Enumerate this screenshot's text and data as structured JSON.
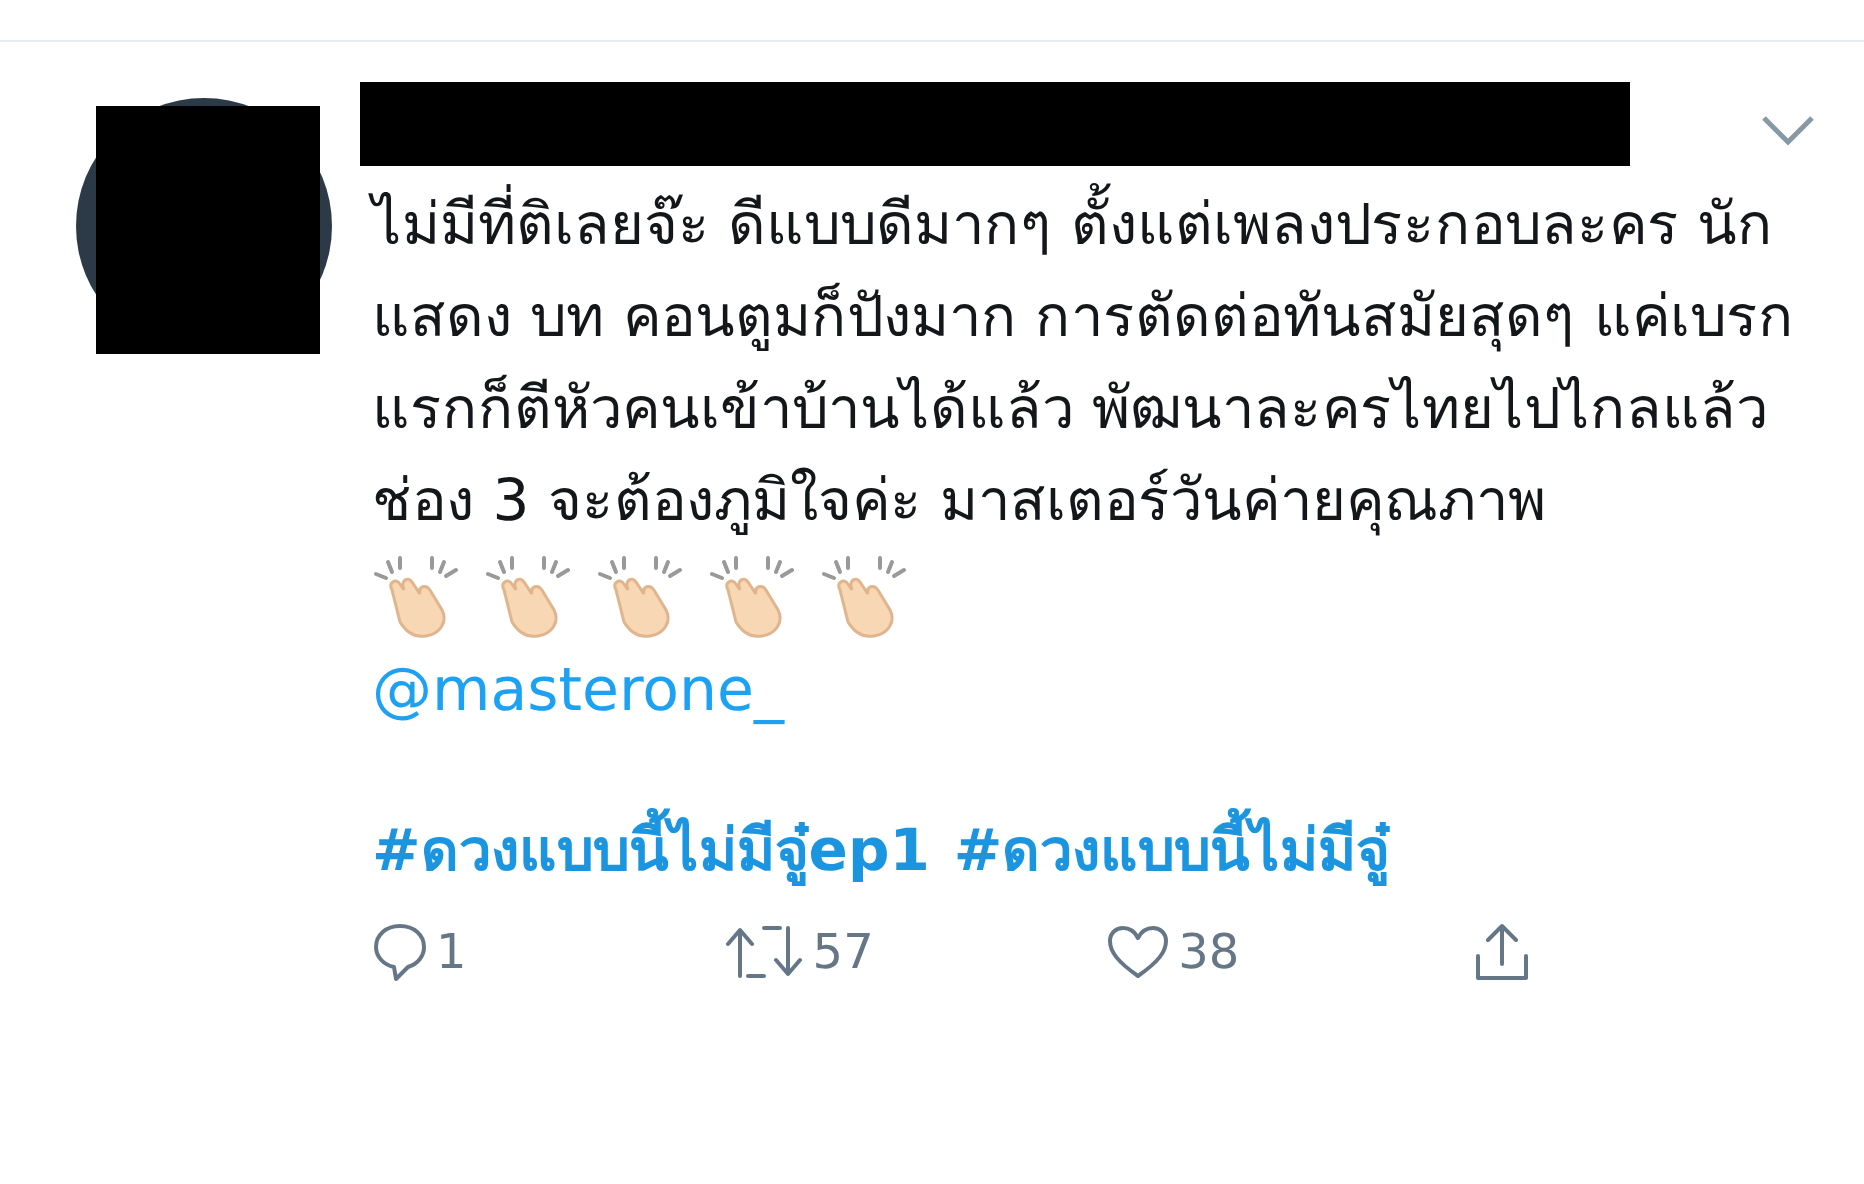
{
  "tweet": {
    "text": "ไม่มีที่ติเลยจ๊ะ ดีแบบดีมากๆ ตั้งแต่เพลงประกอบละคร นักแสดง บท คอนตูมก็ปังมาก การตัดต่อทันสมัยสุดๆ แค่เบรกแรกก็ตีหัวคนเข้าบ้านได้แล้ว พัฒนาละครไทยไปไกลแล้ว ช่อง 3 จะต้องภูมิใจค่ะ มาสเตอร์วันค่ายคุณภาพ",
    "emojis": [
      {
        "kind": "clap"
      },
      {
        "kind": "clap"
      },
      {
        "kind": "clap"
      },
      {
        "kind": "clap"
      },
      {
        "kind": "clap"
      }
    ],
    "mention": "@masterone_",
    "hashtags": [
      "#ดวงแบบนี้ไม่มีจู๋ep1",
      "#ดวงแบบนี้ไม่มีจู๋"
    ],
    "actions": [
      {
        "kind": "reply",
        "count": "1"
      },
      {
        "kind": "retweet",
        "count": "57"
      },
      {
        "kind": "like",
        "count": "38"
      },
      {
        "kind": "share"
      }
    ]
  }
}
